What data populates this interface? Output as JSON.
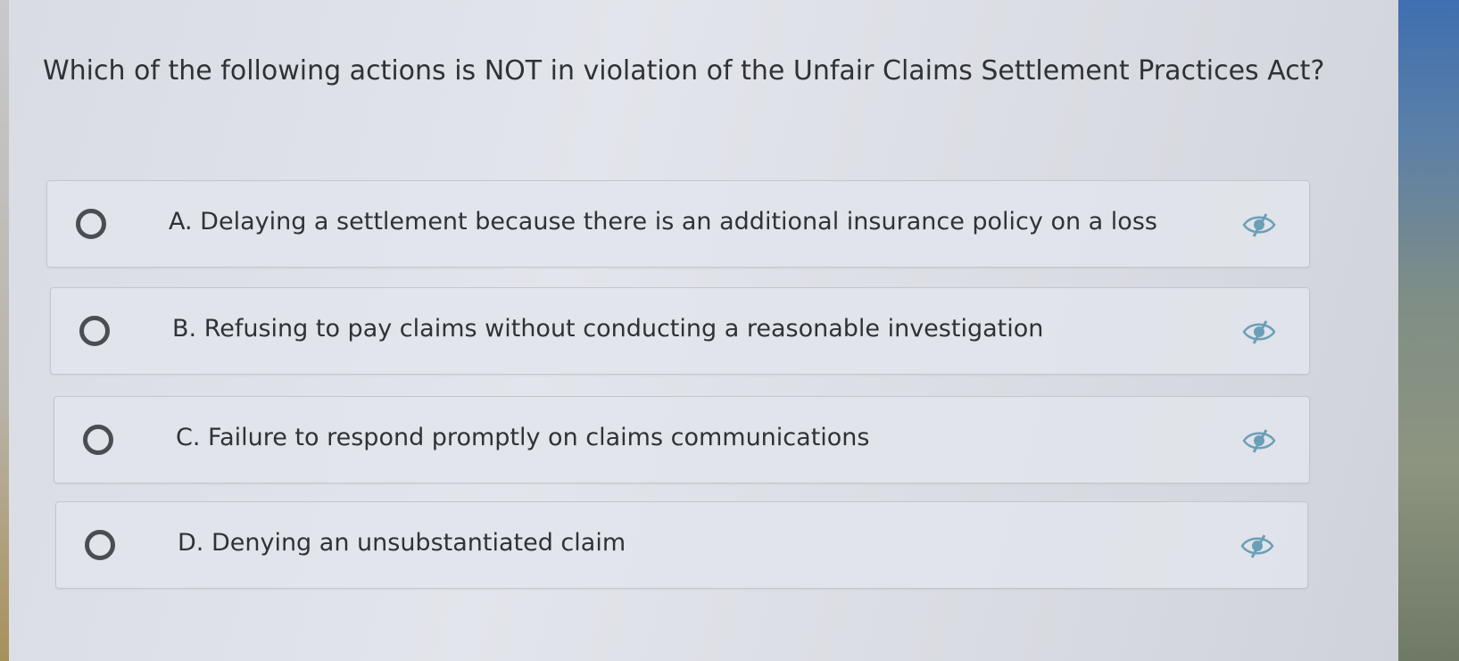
{
  "question": {
    "text": "Which of the following actions is NOT in violation of the Unfair Claims Settlement Practices Act?"
  },
  "options": [
    {
      "label": "A. Delaying a settlement because there is an additional insurance policy on a loss"
    },
    {
      "label": "B. Refusing to pay claims without conducting a reasonable investigation"
    },
    {
      "label": "C. Failure to respond promptly on claims communications"
    },
    {
      "label": "D. Denying an unsubstantiated claim"
    }
  ],
  "icons": {
    "radio": "radio-empty-icon",
    "eliminate": "strikethrough-eye-icon"
  },
  "colors": {
    "text": "#2f3236",
    "radio_border": "#4a4d52",
    "eliminate_icon": "#6b9fb8",
    "card_border": "#c3c6cc"
  }
}
